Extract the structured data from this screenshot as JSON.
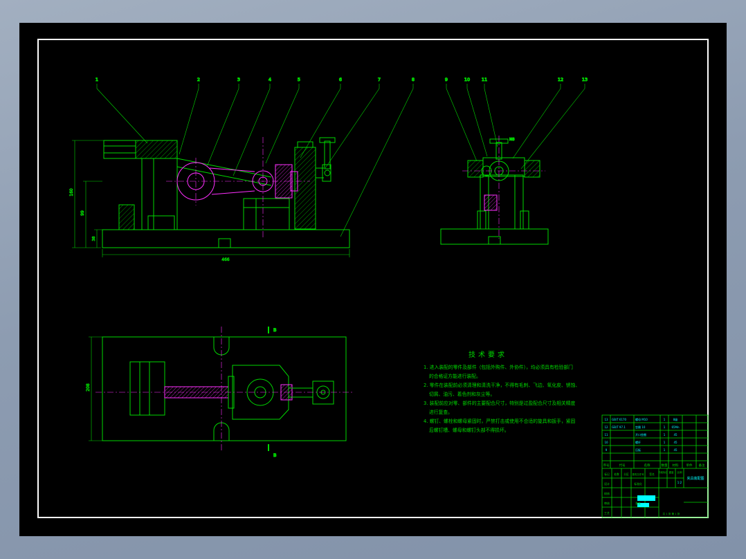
{
  "colors": {
    "background": "#8d9cb1",
    "paper": "#000000",
    "frame": "#ffffff",
    "line_green": "#00d800",
    "line_magenta": "#ff30ff",
    "text_cyan": "#00ffff"
  },
  "balloons": [
    "1",
    "2",
    "3",
    "4",
    "5",
    "6",
    "7",
    "8",
    "9",
    "10",
    "11",
    "12",
    "13"
  ],
  "dims": {
    "side_overall": "160",
    "side_mid": "99",
    "side_lower": "38",
    "side_width": "466",
    "plan_depth": "208",
    "thread": "M8"
  },
  "section": {
    "label": "B"
  },
  "tech": {
    "title": "技术要求",
    "lines": [
      "1. 进入装配的零件及部件（包括外购件、外协件），均必须具有检验部门",
      "的合格证方能进行装配。",
      "2. 零件在装配前必须清理和清洗干净，不得有毛刺、飞边、氧化皮、锈蚀、",
      "切屑、油污、着色剂和灰尘等。",
      "3. 装配前应对零、部件的主要配合尺寸，特别是过盈配合尺寸及相关精度",
      "进行复查。",
      "4. 螺钉、螺栓和螺母紧固时，严禁打击或使用不合适的旋具和扳手，紧固",
      "后螺钉槽、螺母和螺钉头部不得损坏。"
    ]
  },
  "bom": {
    "headers": [
      "序号",
      "代号",
      "名称",
      "数量",
      "材料",
      "单件",
      "备注"
    ],
    "rows": [
      {
        "seq": "13",
        "code": "GB/T 6170",
        "name": "螺母 M10",
        "qty": "1",
        "mat": "8级"
      },
      {
        "seq": "12",
        "code": "GB/T 97.1",
        "name": "垫圈 10",
        "qty": "1",
        "mat": "65Mn"
      },
      {
        "seq": "11",
        "code": "",
        "name": "开口垫圈",
        "qty": "1",
        "mat": "45"
      },
      {
        "seq": "10",
        "code": "",
        "name": "螺杆",
        "qty": "1",
        "mat": "45"
      },
      {
        "seq": "9",
        "code": "",
        "name": "压板",
        "qty": "1",
        "mat": "45"
      }
    ]
  },
  "title_block": {
    "rev": [
      "标记",
      "处数",
      "分区",
      "更改文件号",
      "签名"
    ],
    "roles": [
      "设计",
      "校核",
      "审核",
      "工艺"
    ],
    "roles2": [
      "标准化",
      "批准"
    ],
    "stage": "阶段标记",
    "weight": "重量",
    "scale": "比例",
    "scale_value": "1:2",
    "sheet": "共 1 张 第 1 张",
    "title": "夹具装配图"
  }
}
